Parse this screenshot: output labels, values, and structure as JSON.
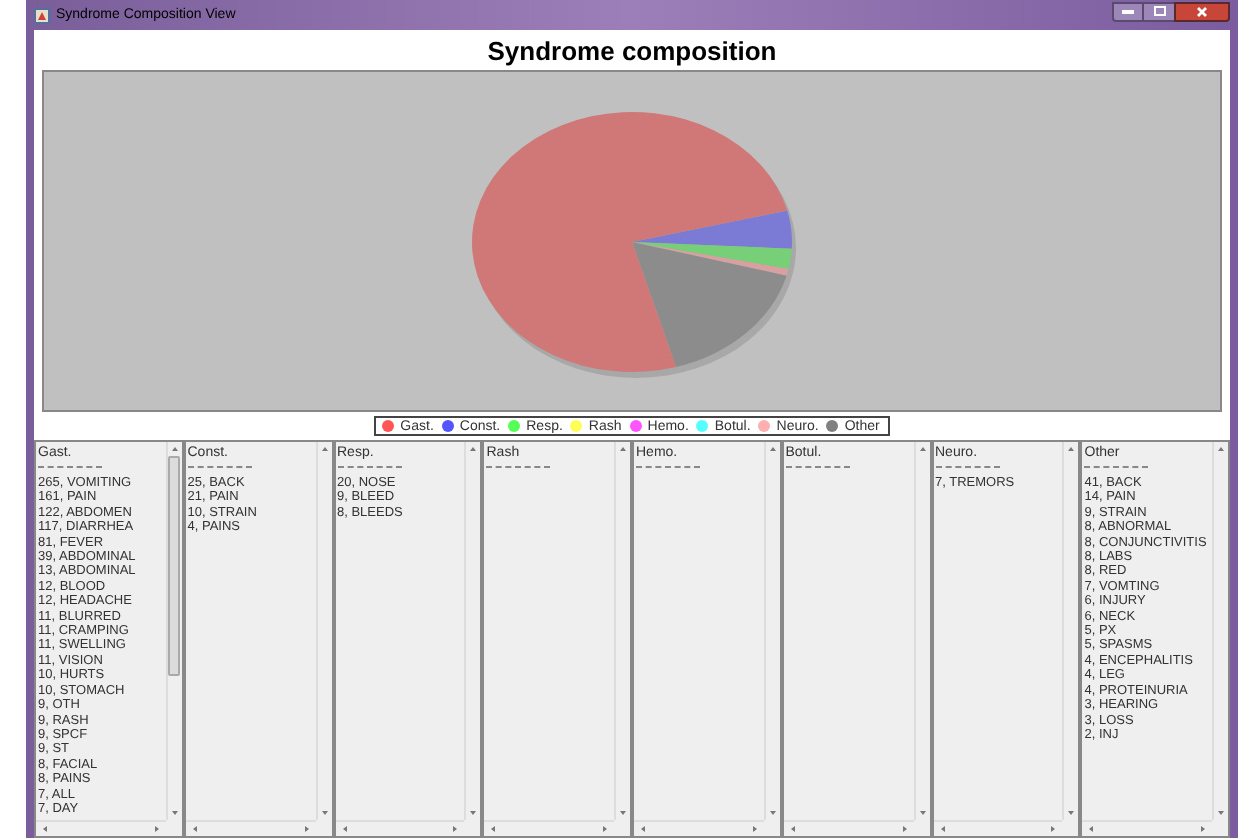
{
  "window": {
    "title": "Syndrome Composition View"
  },
  "heading": "Syndrome composition",
  "legend": [
    {
      "label": "Gast.",
      "color": "#ff5555"
    },
    {
      "label": "Const.",
      "color": "#5555ff"
    },
    {
      "label": "Resp.",
      "color": "#55ff55"
    },
    {
      "label": "Rash",
      "color": "#ffff55"
    },
    {
      "label": "Hemo.",
      "color": "#ff55ff"
    },
    {
      "label": "Botul.",
      "color": "#55ffff"
    },
    {
      "label": "Neuro.",
      "color": "#ffafaf"
    },
    {
      "label": "Other",
      "color": "#808080"
    }
  ],
  "lists": [
    {
      "header": "Gast.",
      "items": [
        "265, VOMITING",
        "161, PAIN",
        "122, ABDOMEN",
        "117, DIARRHEA",
        "81, FEVER",
        "39, ABDOMINAL",
        "13, ABDOMINAL",
        "12, BLOOD",
        "12, HEADACHE",
        "11, BLURRED",
        "11, CRAMPING",
        "11, SWELLING",
        "11, VISION",
        "10, HURTS",
        "10, STOMACH",
        "9, OTH",
        "9, RASH",
        "9, SPCF",
        "9, ST",
        "8, FACIAL",
        "8, PAINS",
        "7, ALL",
        "7, DAY"
      ]
    },
    {
      "header": "Const.",
      "items": [
        "25, BACK",
        "21, PAIN",
        "10, STRAIN",
        "4, PAINS"
      ]
    },
    {
      "header": "Resp.",
      "items": [
        "20, NOSE",
        "9, BLEED",
        "8, BLEEDS"
      ]
    },
    {
      "header": "Rash"
    },
    {
      "header": "Hemo."
    },
    {
      "header": "Botul."
    },
    {
      "header": "Neuro.",
      "items": [
        "7, TREMORS"
      ]
    },
    {
      "header": "Other",
      "items": [
        "41, BACK",
        "14, PAIN",
        "9, STRAIN",
        "8, ABNORMAL",
        "8, CONJUNCTIVITIS",
        "8, LABS",
        "8, RED",
        "7, VOMTING",
        "6, INJURY",
        "6, NECK",
        "5, PX",
        "5, SPASMS",
        "4, ENCEPHALITIS",
        "4, LEG",
        "4, PROTEINURIA",
        "3, HEARING",
        "3, LOSS",
        "2, INJ"
      ]
    }
  ]
}
